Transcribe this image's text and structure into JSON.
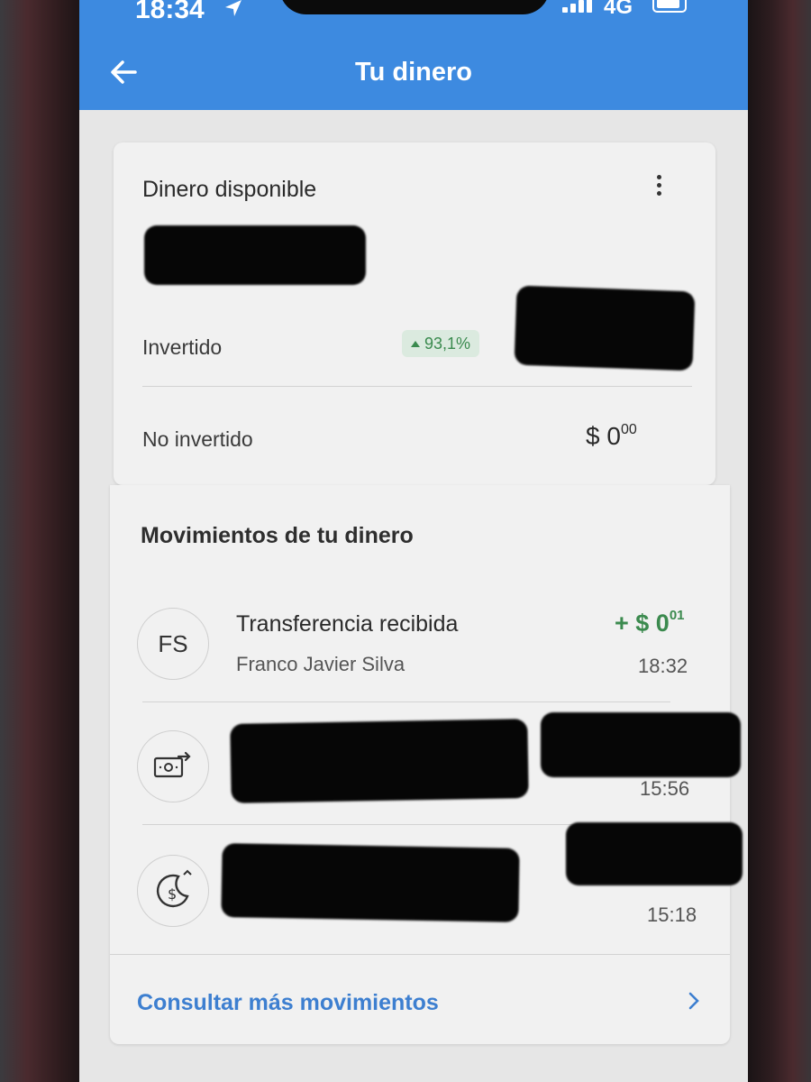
{
  "status_bar": {
    "time": "18:34",
    "network": "4G"
  },
  "header": {
    "title": "Tu dinero"
  },
  "balance": {
    "title": "Dinero disponible",
    "invested_label": "Invertido",
    "invested_change": "93,1%",
    "not_invested_label": "No invertido",
    "not_invested_amount_main": "$ 0",
    "not_invested_amount_cents": "00"
  },
  "movements": {
    "title": "Movimientos de tu dinero",
    "items": [
      {
        "avatar": "FS",
        "title": "Transferencia recibida",
        "subtitle": "Franco Javier Silva",
        "amount_main": "+ $ 0",
        "amount_cents": "01",
        "time": "18:32"
      },
      {
        "icon": "money-transfer-icon",
        "time": "15:56"
      },
      {
        "icon": "moon-dollar-icon",
        "time": "15:18"
      }
    ],
    "more_link": "Consultar más movimientos"
  },
  "colors": {
    "header": "#3d8ae0",
    "positive": "#3b8a4e",
    "link": "#3d7fd0"
  }
}
